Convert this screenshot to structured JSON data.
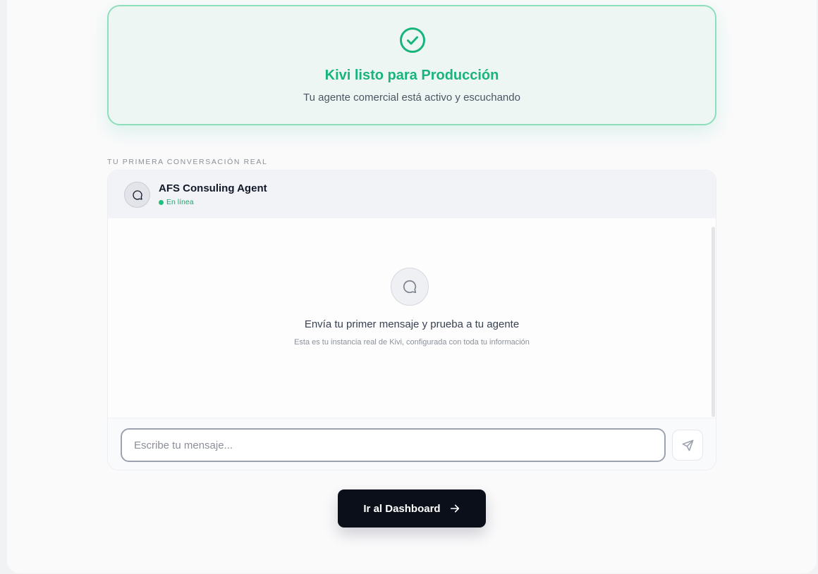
{
  "success": {
    "title": "Kivi listo para Producción",
    "subtitle": "Tu agente comercial está activo y escuchando",
    "icon": "check-circle-icon",
    "accent_color": "#17b57c"
  },
  "conversation": {
    "section_label": "TU PRIMERA CONVERSACIÓN REAL",
    "agent_name": "AFS Consuling Agent",
    "agent_status": "En línea",
    "agent_icon": "chat-bubble-icon",
    "empty_title": "Envía tu primer mensaje y prueba a tu agente",
    "empty_subtitle": "Esta es tu instancia real de Kivi, configurada con toda tu información",
    "input_placeholder": "Escribe tu mensaje...",
    "send_icon": "send-icon"
  },
  "actions": {
    "dashboard_label": "Ir al Dashboard",
    "dashboard_icon": "arrow-right-icon"
  }
}
